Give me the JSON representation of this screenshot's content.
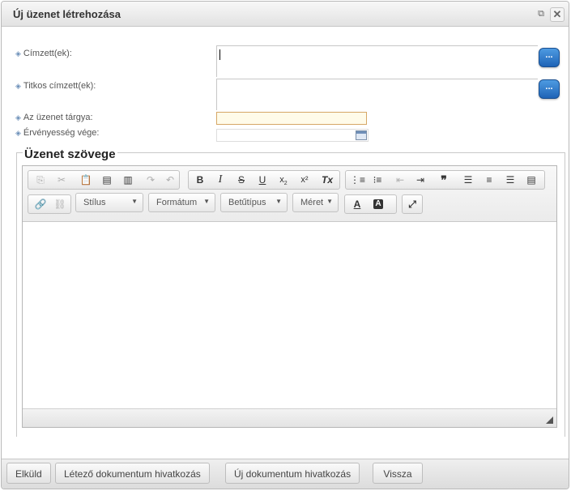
{
  "dialog": {
    "title": "Új üzenet létrehozása",
    "popout_glyph": "⧉",
    "close_glyph": "✕"
  },
  "fields": {
    "recipients_label": "Címzett(ek):",
    "bcc_label": "Titkos címzett(ek):",
    "subject_label": "Az üzenet tárgya:",
    "expiry_label": "Érvényesség vége:",
    "picker_label": "...",
    "bullet": "◈"
  },
  "message_section": {
    "legend": "Üzenet szövege"
  },
  "editor_toolbar": {
    "style_combo": "Stílus",
    "format_combo": "Formátum",
    "font_combo": "Betűtípus",
    "size_combo": "Méret",
    "bold": "B",
    "italic": "I",
    "strike": "S",
    "underline": "U",
    "subscript": "x",
    "superscript": "x²",
    "remove_format": "Tx",
    "quote": "❞",
    "text_color": "A",
    "bg_color": "A",
    "icons": {
      "copy": "copy-icon",
      "cut": "cut-icon",
      "paste": "paste-icon",
      "paste_text": "paste-text-icon",
      "paste_word": "paste-word-icon",
      "redo": "redo-icon",
      "undo": "undo-icon",
      "numbered_list": "numbered-list-icon",
      "bulleted_list": "bulleted-list-icon",
      "outdent": "outdent-icon",
      "indent": "indent-icon",
      "align_left": "align-left-icon",
      "align_center": "align-center-icon",
      "align_right": "align-right-icon",
      "justify": "justify-icon",
      "link": "link-icon",
      "unlink": "unlink-icon",
      "maximize": "maximize-icon"
    }
  },
  "footer": {
    "send": "Elküld",
    "existing_doc_link": "Létező dokumentum hivatkozás",
    "new_doc_link": "Új dokumentum hivatkozás",
    "back": "Vissza"
  },
  "colors": {
    "accent_button": "#2a76c9",
    "subject_border": "#d6a766",
    "subject_bg": "#fffbe9"
  }
}
